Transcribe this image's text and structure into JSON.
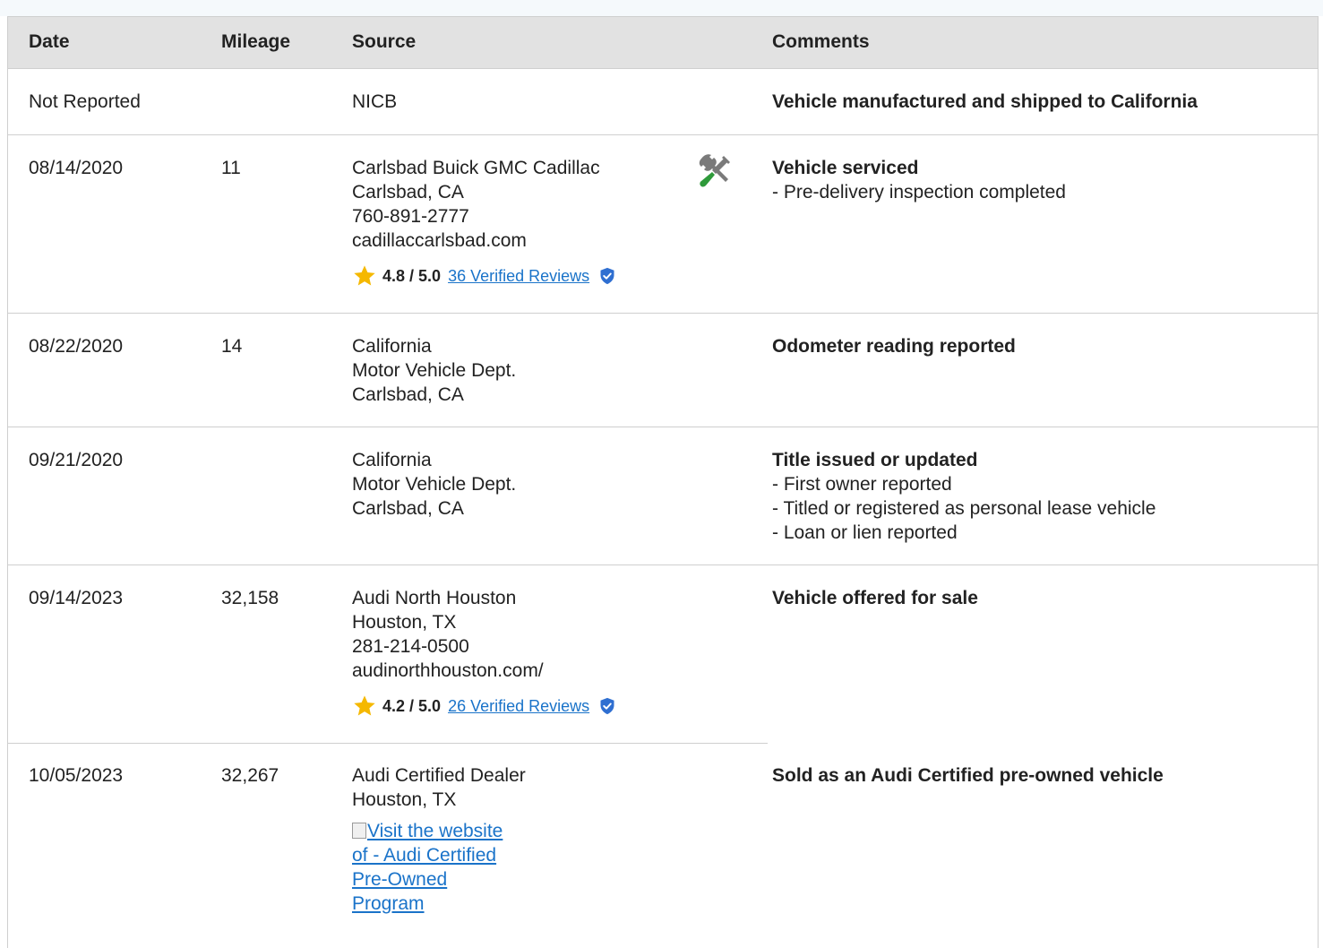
{
  "headers": {
    "date": "Date",
    "mileage": "Mileage",
    "source": "Source",
    "comments": "Comments"
  },
  "rows": [
    {
      "date": "Not Reported",
      "mileage": "",
      "source": [
        "NICB"
      ],
      "comment_title": "Vehicle manufactured and shipped to California",
      "comment_items": []
    },
    {
      "date": "08/14/2020",
      "mileage": "11",
      "source": [
        "Carlsbad Buick GMC Cadillac",
        "Carlsbad, CA",
        "760-891-2777",
        "cadillaccarlsbad.com"
      ],
      "rating_score": "4.8 / 5.0",
      "rating_link": "36 Verified Reviews",
      "service_icon": "wrench-screwdriver-icon",
      "comment_title": "Vehicle serviced",
      "comment_items": [
        "- Pre-delivery inspection completed"
      ]
    },
    {
      "date": "08/22/2020",
      "mileage": "14",
      "source": [
        "California",
        "Motor Vehicle Dept.",
        "Carlsbad, CA"
      ],
      "comment_title": "Odometer reading reported",
      "comment_items": []
    },
    {
      "date": "09/21/2020",
      "mileage": "",
      "source": [
        "California",
        "Motor Vehicle Dept.",
        "Carlsbad, CA"
      ],
      "comment_title": "Title issued or updated",
      "comment_items": [
        "- First owner reported",
        "- Titled or registered as personal lease vehicle",
        "- Loan or lien reported"
      ]
    },
    {
      "date": "09/14/2023",
      "mileage": "32,158",
      "source": [
        "Audi North Houston",
        "Houston, TX",
        "281-214-0500",
        "audinorthhouston.com/"
      ],
      "rating_score": "4.2 / 5.0",
      "rating_link": "26 Verified Reviews",
      "comment_title": "Vehicle offered for sale",
      "comment_items": []
    },
    {
      "date": "10/05/2023",
      "mileage": "32,267",
      "source": [
        "Audi Certified Dealer",
        "Houston, TX"
      ],
      "image_link_alt": "Visit the website of - Audi Certified Pre-Owned Program",
      "comment_title": "Sold as an Audi Certified pre-owned vehicle",
      "comment_items": []
    }
  ],
  "colors": {
    "link": "#1a73c9",
    "star": "#f5b800",
    "shield": "#2f6fd1",
    "header_bg": "#e2e2e2",
    "border": "#cfcfcf"
  }
}
